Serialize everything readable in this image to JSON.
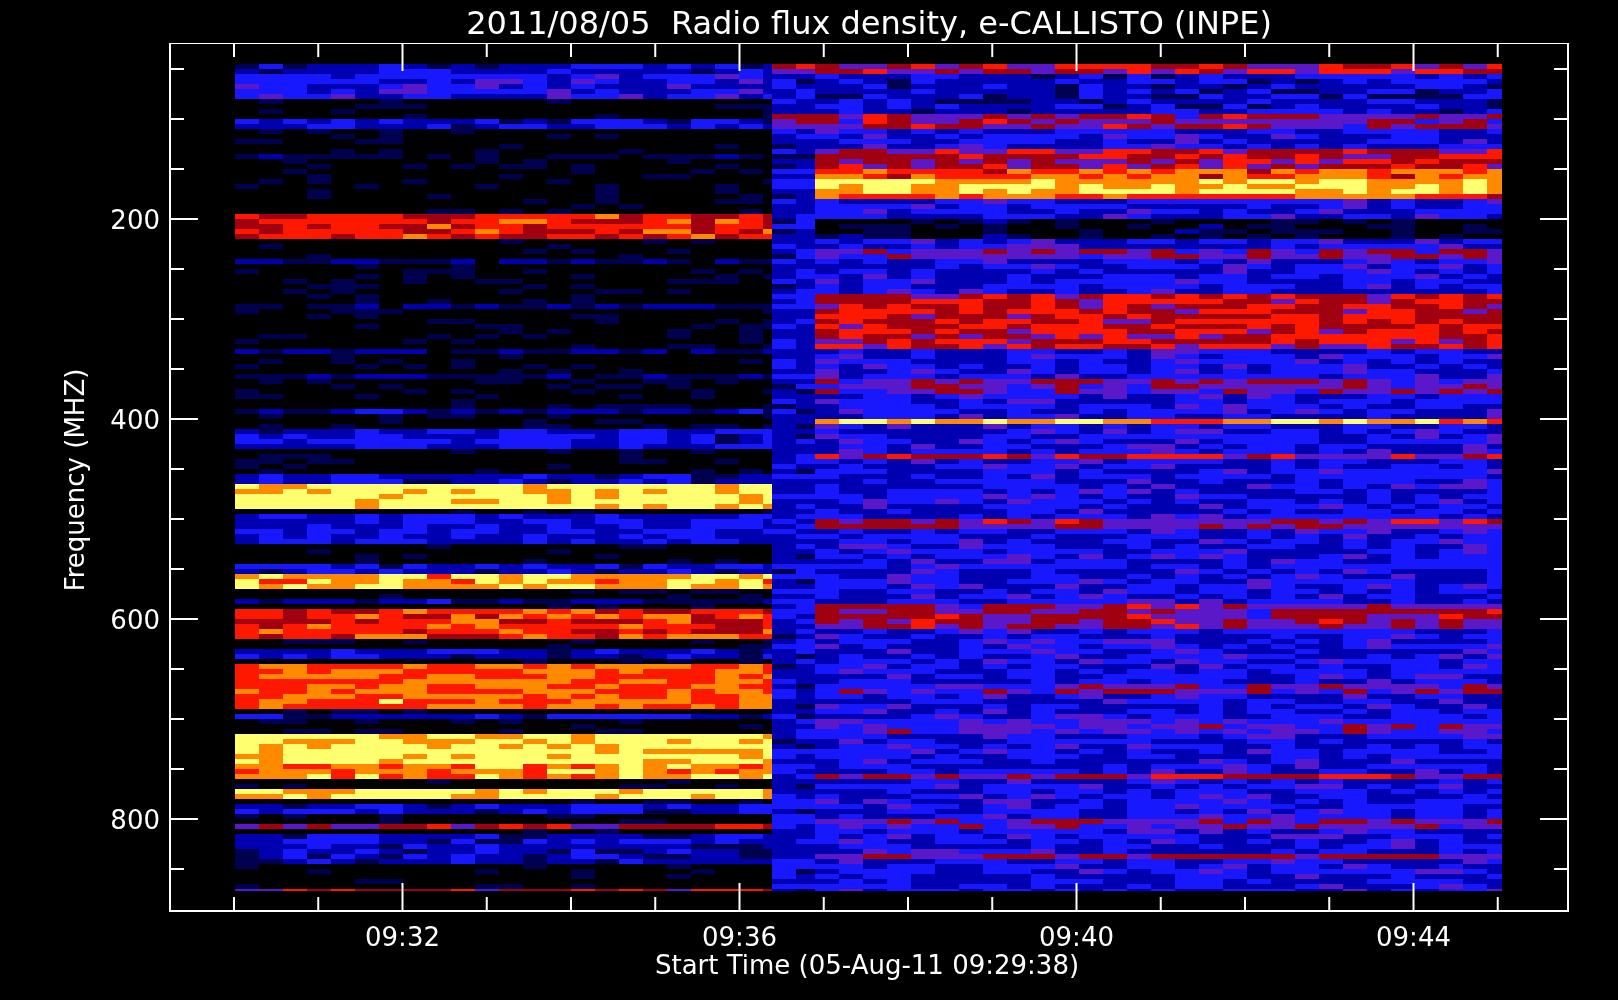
{
  "title": "2011/08/05  Radio flux density, e-CALLISTO (INPE)",
  "y_axis": {
    "title": "Frequency (MHZ)",
    "ticks": [
      "200",
      "400",
      "600",
      "800"
    ]
  },
  "x_axis": {
    "title": "Start Time (05-Aug-11 09:29:38)",
    "ticks": [
      "09:32",
      "09:36",
      "09:40",
      "09:44"
    ]
  }
}
